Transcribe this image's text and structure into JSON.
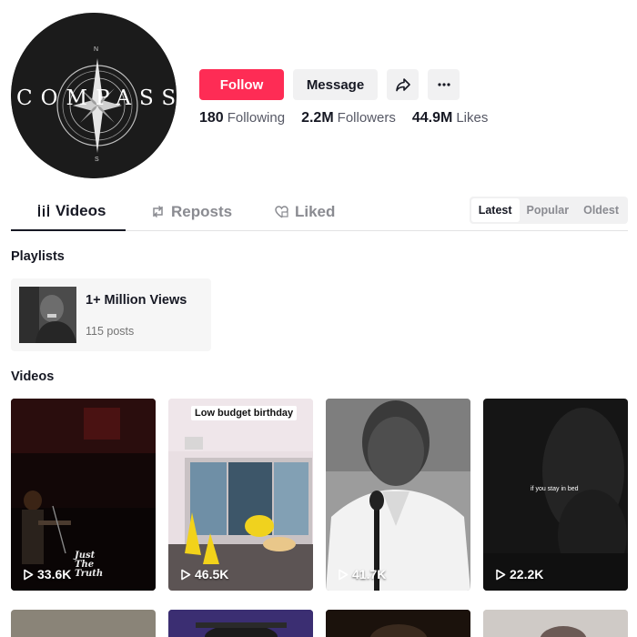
{
  "profile": {
    "logo_text": "COMPASS",
    "compass_n": "N",
    "compass_s": "S"
  },
  "actions": {
    "follow_label": "Follow",
    "message_label": "Message",
    "share_icon": "share-icon",
    "more_icon": "more-icon"
  },
  "stats": {
    "following_count": "180",
    "following_label": "Following",
    "followers_count": "2.2M",
    "followers_label": "Followers",
    "likes_count": "44.9M",
    "likes_label": "Likes"
  },
  "tabs": {
    "videos": "Videos",
    "reposts": "Reposts",
    "liked": "Liked"
  },
  "sort": {
    "latest": "Latest",
    "popular": "Popular",
    "oldest": "Oldest"
  },
  "playlists": {
    "heading": "Playlists",
    "items": [
      {
        "title": "1+ Million Views",
        "count": "115 posts"
      }
    ]
  },
  "videos": {
    "heading": "Videos",
    "items": [
      {
        "views": "33.6K",
        "watermark_1": "Just",
        "watermark_2": "The",
        "watermark_3": "Truth"
      },
      {
        "views": "46.5K",
        "caption": "Low budget birthday"
      },
      {
        "views": "41.7K"
      },
      {
        "views": "22.2K",
        "overlay": "if you stay in bed"
      }
    ]
  },
  "colors": {
    "accent": "#fe2c55",
    "text": "#161823",
    "muted": "#8a8b91"
  }
}
